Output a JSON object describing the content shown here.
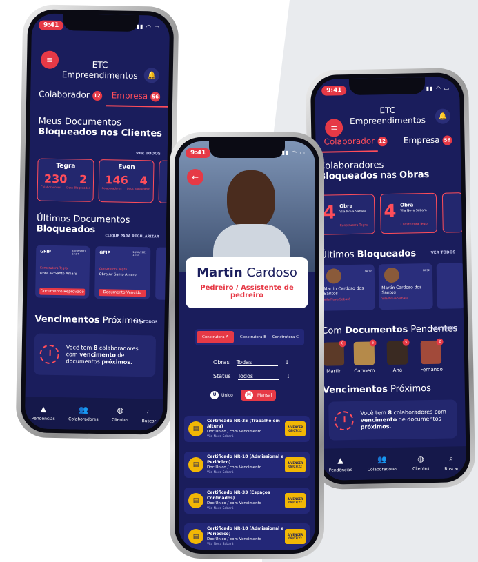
{
  "time": "9:41",
  "left": {
    "title1": "ETC",
    "title2": "Empreendimentos",
    "tab1": "Colaborador",
    "tab1_count": "12",
    "tab2": "Empresa",
    "tab2_count": "56",
    "sec1a": "Meus Documentos",
    "sec1b": "Bloqueados nos Clientes",
    "ver_todos": "VER TODOS",
    "clients": [
      {
        "name": "Tegra",
        "n1": "230",
        "l1": "Colaboradores",
        "n2": "2",
        "l2": "Docs Bloqueados"
      },
      {
        "name": "Even",
        "n1": "146",
        "l1": "Colaboradores",
        "n2": "4",
        "l2": "Docs Bloqueados"
      }
    ],
    "sec2a": "Últimos Documentos",
    "sec2b": "Bloqueados",
    "regularizar": "CLIQUE PARA REGULARIZAR",
    "docs": [
      {
        "name": "GFIP",
        "date": "10/10/2021 13:14",
        "client": "Construtora Tegra",
        "place": "Obra Av Santo Amaro",
        "status": "Documento Reprovado"
      },
      {
        "name": "GFIP",
        "date": "10/10/2021 13:14",
        "client": "Construtora Tegra",
        "place": "Obra Av Santo Amaro",
        "status": "Documento Vencido"
      }
    ],
    "sec3a": "Vencimentos",
    "sec3b": "Próximos",
    "venc1": "Você tem ",
    "venc_n": "8",
    "venc2": " colaboradores com ",
    "venc3": "vencimento",
    "venc4": " de documentos ",
    "venc5": "próximos.",
    "nav": [
      "Pendências",
      "Colaboradores",
      "Clientes",
      "Buscar"
    ]
  },
  "center": {
    "first": "Martin",
    "last": "Cardoso",
    "role": "Pedreiro / Assistente de pedreiro",
    "tabs": [
      "Construtora A",
      "Construtora B",
      "Construtora C"
    ],
    "obras_label": "Obras",
    "obras_val": "Todas",
    "status_label": "Status",
    "status_val": "Todos",
    "opt1": "Único",
    "opt2": "Mensal",
    "certs": [
      {
        "title": "Certificado NR-35 (Trabalho em Altura)",
        "sub": "Doc Único / com Vencimento",
        "place": "Vila Nova Sabará",
        "action": "A VENCER 08/07/22"
      },
      {
        "title": "Certificado NR-18 (Admissional e Periódico)",
        "sub": "Doc Único / com Vencimento",
        "place": "Vila Nova Sabará",
        "action": "A VENCER 08/07/22"
      },
      {
        "title": "Certificado NR-33 (Espaços Confinados)",
        "sub": "Doc Único / com Vencimento",
        "place": "Vila Nova Sabará",
        "action": "A VENCER 08/07/22"
      },
      {
        "title": "Certificado NR-18 (Admissional e Periódico)",
        "sub": "Doc Único / com Vencimento",
        "place": "Vila Nova Sabará",
        "action": "A VENCER 08/07/22"
      }
    ]
  },
  "right": {
    "title1": "ETC",
    "title2": "Empreendimentos",
    "tab1": "Colaborador",
    "tab1_count": "12",
    "tab2": "Empresa",
    "tab2_count": "56",
    "sec1a": "Colaboradores",
    "sec1b": "Bloqueados",
    "sec1c": " nas ",
    "sec1d": "Obras",
    "obras": [
      {
        "n": "4",
        "name": "Obra",
        "place": "Vila Nova Sabará",
        "client": "Construtora Tegra"
      },
      {
        "n": "4",
        "name": "Obra",
        "place": "Vila Nova Sabará",
        "client": "Construtora Tegra"
      }
    ],
    "sec2a": "Últimos ",
    "sec2b": "Bloqueados",
    "ver_todos": "VER TODOS",
    "blocked": [
      {
        "name": "Martin Cardoso dos Santos",
        "time": "06:32",
        "place": "Vila Nova Sabará"
      },
      {
        "name": "Martin Cardoso dos Santos",
        "time": "06:32",
        "place": "Vila Nova Sabará"
      }
    ],
    "sec3a": "Com ",
    "sec3b": "Documentos",
    "sec3c": " Pendentes",
    "people": [
      {
        "name": "Martin",
        "count": "8"
      },
      {
        "name": "Carmem",
        "count": "6"
      },
      {
        "name": "Ana",
        "count": "5"
      },
      {
        "name": "Fernando",
        "count": "2"
      }
    ],
    "sec4a": "Vencimentos",
    "sec4b": "Próximos",
    "nav": [
      "Pendências",
      "Colaboradores",
      "Clientes",
      "Buscar"
    ]
  }
}
